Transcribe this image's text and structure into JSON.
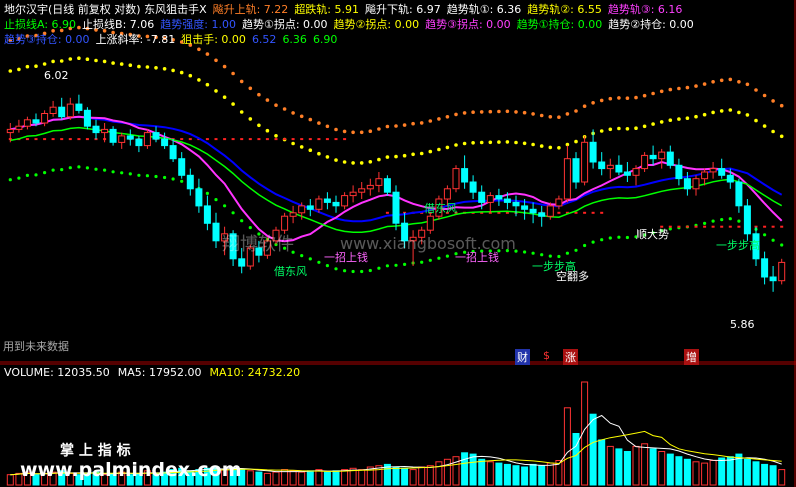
{
  "header": {
    "row1": [
      {
        "text": "地尔汉宇(日线 前复权 对数) 东风狙击手X",
        "color": "#ffffff"
      },
      {
        "text": "飚升上轨: 7.22",
        "color": "#ff7f27"
      },
      {
        "text": "超跌轨: 5.91",
        "color": "#ffff00"
      },
      {
        "text": "飚升下轨: 6.97",
        "color": "#ffffff"
      },
      {
        "text": "趋势轨①: 6.36",
        "color": "#ffffff"
      },
      {
        "text": "趋势轨②: 6.55",
        "color": "#ffff00"
      },
      {
        "text": "趋势轨③: 6.16",
        "color": "#ff40ff"
      }
    ],
    "row2": [
      {
        "text": "止损线A: 6.90",
        "color": "#00ff00"
      },
      {
        "text": "止损线B: 7.06",
        "color": "#ffffff"
      },
      {
        "text": "趋势强度: 1.00",
        "color": "#3355ff"
      },
      {
        "text": "趋势①拐点: 0.00",
        "color": "#ffffff"
      },
      {
        "text": "趋势②拐点: 0.00",
        "color": "#ffff00"
      },
      {
        "text": "趋势③拐点: 0.00",
        "color": "#ff40ff"
      },
      {
        "text": "趋势①持仓: 0.00",
        "color": "#00ff00"
      },
      {
        "text": "趋势②持仓: 0.00",
        "color": "#ffffff"
      }
    ],
    "row3": [
      {
        "text": "趋势③持仓: 0.00",
        "color": "#3355ff"
      },
      {
        "text": "上涨斜率: -7.81",
        "color": "#ffffff"
      },
      {
        "text": "狙击手: 0.00",
        "color": "#ffff00"
      },
      {
        "text": "6.52",
        "color": "#3355ff"
      },
      {
        "text": "6.36",
        "color": "#00ff00"
      },
      {
        "text": "6.90",
        "color": "#00ff00"
      }
    ]
  },
  "volume_header": [
    {
      "text": "VOLUME: 12035.50",
      "color": "#ffffff"
    },
    {
      "text": "MA5: 17952.00",
      "color": "#ffffff"
    },
    {
      "text": "MA10: 24732.20",
      "color": "#ffff00"
    }
  ],
  "annotations": {
    "high_label": "6.02",
    "low_label": "5.86",
    "future_data": "用到未来数据",
    "jiedongfeng": "借东风",
    "shunda": "顺大势",
    "bubu": "一步步高",
    "zhang_label": "涨",
    "cai_label": "财",
    "zeng_label": "增",
    "dollar": "$",
    "jiandan_a": "一招上钱",
    "jiandan_b": "空翻多"
  },
  "watermarks": {
    "site_cn": "翔博软件",
    "site_url": "www.xiangbosoft.com",
    "palm_cn": "掌 上 指 标",
    "palm_url": "www.palmindex.com"
  },
  "chart_data": {
    "type": "candlestick",
    "scale": "log",
    "ylim": [
      5.7,
      7.3
    ],
    "high": 6.02,
    "low": 5.86,
    "ohlc": [
      [
        6.78,
        6.84,
        6.72,
        6.8
      ],
      [
        6.8,
        6.86,
        6.78,
        6.82
      ],
      [
        6.82,
        6.88,
        6.8,
        6.86
      ],
      [
        6.86,
        6.9,
        6.82,
        6.84
      ],
      [
        6.84,
        6.92,
        6.82,
        6.9
      ],
      [
        6.9,
        6.98,
        6.88,
        6.94
      ],
      [
        6.94,
        7.0,
        6.86,
        6.88
      ],
      [
        6.88,
        7.0,
        6.86,
        6.96
      ],
      [
        6.96,
        7.02,
        6.9,
        6.92
      ],
      [
        6.92,
        6.94,
        6.8,
        6.82
      ],
      [
        6.82,
        6.86,
        6.74,
        6.78
      ],
      [
        6.78,
        6.84,
        6.72,
        6.8
      ],
      [
        6.8,
        6.82,
        6.7,
        6.72
      ],
      [
        6.72,
        6.78,
        6.68,
        6.76
      ],
      [
        6.76,
        6.8,
        6.7,
        6.74
      ],
      [
        6.74,
        6.76,
        6.66,
        6.7
      ],
      [
        6.7,
        6.8,
        6.68,
        6.78
      ],
      [
        6.78,
        6.82,
        6.72,
        6.74
      ],
      [
        6.74,
        6.78,
        6.68,
        6.7
      ],
      [
        6.7,
        6.74,
        6.6,
        6.62
      ],
      [
        6.62,
        6.66,
        6.5,
        6.52
      ],
      [
        6.52,
        6.56,
        6.4,
        6.44
      ],
      [
        6.44,
        6.5,
        6.3,
        6.34
      ],
      [
        6.34,
        6.4,
        6.2,
        6.24
      ],
      [
        6.24,
        6.3,
        6.1,
        6.14
      ],
      [
        6.14,
        6.22,
        6.06,
        6.18
      ],
      [
        6.18,
        6.2,
        6.0,
        6.04
      ],
      [
        6.04,
        6.1,
        5.96,
        6.0
      ],
      [
        6.0,
        6.12,
        5.98,
        6.1
      ],
      [
        6.1,
        6.14,
        6.02,
        6.06
      ],
      [
        6.06,
        6.16,
        6.04,
        6.14
      ],
      [
        6.14,
        6.22,
        6.12,
        6.2
      ],
      [
        6.2,
        6.3,
        6.18,
        6.28
      ],
      [
        6.28,
        6.34,
        6.24,
        6.3
      ],
      [
        6.3,
        6.36,
        6.26,
        6.34
      ],
      [
        6.34,
        6.38,
        6.28,
        6.32
      ],
      [
        6.32,
        6.4,
        6.3,
        6.38
      ],
      [
        6.38,
        6.42,
        6.32,
        6.36
      ],
      [
        6.36,
        6.4,
        6.3,
        6.34
      ],
      [
        6.34,
        6.42,
        6.32,
        6.4
      ],
      [
        6.4,
        6.46,
        6.36,
        6.42
      ],
      [
        6.42,
        6.48,
        6.38,
        6.44
      ],
      [
        6.44,
        6.5,
        6.4,
        6.46
      ],
      [
        6.46,
        6.54,
        6.42,
        6.5
      ],
      [
        6.5,
        6.52,
        6.4,
        6.42
      ],
      [
        6.42,
        6.46,
        6.2,
        6.24
      ],
      [
        6.24,
        6.3,
        6.1,
        6.14
      ],
      [
        6.14,
        6.2,
        6.0,
        6.16
      ],
      [
        6.16,
        6.22,
        6.12,
        6.2
      ],
      [
        6.2,
        6.3,
        6.18,
        6.28
      ],
      [
        6.28,
        6.4,
        6.26,
        6.38
      ],
      [
        6.38,
        6.46,
        6.34,
        6.44
      ],
      [
        6.44,
        6.58,
        6.42,
        6.56
      ],
      [
        6.56,
        6.64,
        6.44,
        6.48
      ],
      [
        6.48,
        6.52,
        6.38,
        6.42
      ],
      [
        6.42,
        6.46,
        6.32,
        6.36
      ],
      [
        6.36,
        6.42,
        6.3,
        6.4
      ],
      [
        6.4,
        6.44,
        6.34,
        6.38
      ],
      [
        6.38,
        6.42,
        6.32,
        6.36
      ],
      [
        6.36,
        6.4,
        6.28,
        6.34
      ],
      [
        6.34,
        6.38,
        6.26,
        6.32
      ],
      [
        6.32,
        6.36,
        6.24,
        6.3
      ],
      [
        6.3,
        6.34,
        6.22,
        6.28
      ],
      [
        6.28,
        6.36,
        6.26,
        6.34
      ],
      [
        6.34,
        6.4,
        6.32,
        6.38
      ],
      [
        6.38,
        6.7,
        6.36,
        6.62
      ],
      [
        6.62,
        6.66,
        6.44,
        6.48
      ],
      [
        6.48,
        6.76,
        6.46,
        6.72
      ],
      [
        6.72,
        6.8,
        6.56,
        6.6
      ],
      [
        6.6,
        6.66,
        6.52,
        6.56
      ],
      [
        6.56,
        6.62,
        6.5,
        6.58
      ],
      [
        6.58,
        6.64,
        6.52,
        6.54
      ],
      [
        6.54,
        6.6,
        6.48,
        6.52
      ],
      [
        6.52,
        6.58,
        6.46,
        6.56
      ],
      [
        6.56,
        6.66,
        6.54,
        6.64
      ],
      [
        6.64,
        6.7,
        6.58,
        6.62
      ],
      [
        6.62,
        6.68,
        6.56,
        6.66
      ],
      [
        6.66,
        6.7,
        6.56,
        6.58
      ],
      [
        6.58,
        6.62,
        6.46,
        6.5
      ],
      [
        6.5,
        6.54,
        6.4,
        6.44
      ],
      [
        6.44,
        6.52,
        6.4,
        6.5
      ],
      [
        6.5,
        6.56,
        6.46,
        6.54
      ],
      [
        6.54,
        6.6,
        6.5,
        6.56
      ],
      [
        6.56,
        6.62,
        6.5,
        6.52
      ],
      [
        6.52,
        6.56,
        6.44,
        6.48
      ],
      [
        6.48,
        6.5,
        6.3,
        6.34
      ],
      [
        6.34,
        6.38,
        6.14,
        6.18
      ],
      [
        6.18,
        6.22,
        6.0,
        6.04
      ],
      [
        6.04,
        6.08,
        5.9,
        5.94
      ],
      [
        5.94,
        6.0,
        5.86,
        5.92
      ],
      [
        5.92,
        6.04,
        5.9,
        6.02
      ]
    ],
    "volume": [
      8,
      9,
      10,
      8,
      9,
      10,
      11,
      9,
      8,
      9,
      10,
      8,
      9,
      10,
      8,
      9,
      11,
      9,
      10,
      12,
      13,
      11,
      12,
      13,
      14,
      12,
      13,
      12,
      11,
      10,
      9,
      10,
      12,
      11,
      10,
      11,
      12,
      10,
      11,
      12,
      13,
      12,
      14,
      15,
      16,
      14,
      13,
      12,
      14,
      15,
      18,
      20,
      22,
      25,
      24,
      20,
      18,
      17,
      16,
      15,
      14,
      16,
      15,
      17,
      19,
      60,
      40,
      80,
      55,
      35,
      30,
      28,
      26,
      30,
      32,
      28,
      26,
      24,
      22,
      20,
      18,
      17,
      19,
      21,
      22,
      24,
      20,
      18,
      16,
      15,
      12
    ]
  }
}
